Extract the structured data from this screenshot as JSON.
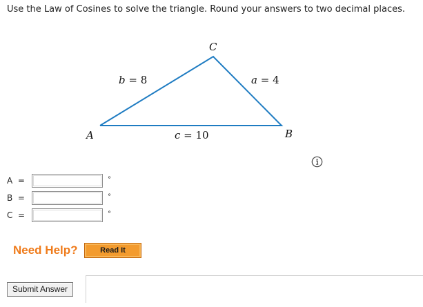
{
  "question": {
    "instructions": "Use the Law of Cosines to solve the triangle. Round your answers to two decimal places."
  },
  "triangle": {
    "vertices": {
      "A": "A",
      "B": "B",
      "C": "C"
    },
    "sides": {
      "b": {
        "name": "b",
        "eq": " = ",
        "value": "8"
      },
      "a": {
        "name": "a",
        "eq": " = ",
        "value": "4"
      },
      "c": {
        "name": "c",
        "eq": " = ",
        "value": "10"
      }
    },
    "line_color": "#1f7cc2",
    "info_icon": "info-circle-icon"
  },
  "answers": [
    {
      "label": "A  =",
      "value": "",
      "unit": "°"
    },
    {
      "label": "B  =",
      "value": "",
      "unit": "°"
    },
    {
      "label": "C  =",
      "value": "",
      "unit": "°"
    }
  ],
  "help": {
    "need_help": "Need Help?",
    "read_it": "Read It",
    "accent_color": "#ef7b1b"
  },
  "submit": {
    "label": "Submit Answer"
  }
}
